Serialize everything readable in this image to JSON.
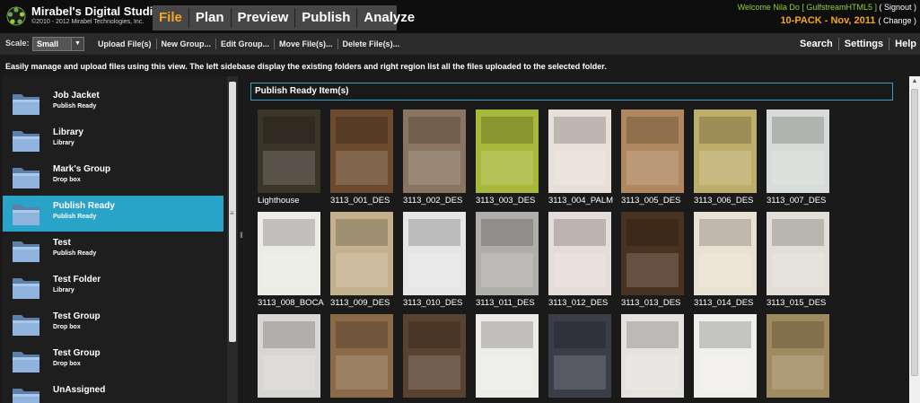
{
  "app": {
    "title": "Mirabel's Digital Studio",
    "copyright": "©2010 - 2012 Mirabel Technologies, Inc."
  },
  "nav": {
    "tabs": [
      {
        "label": "File",
        "active": true
      },
      {
        "label": "Plan"
      },
      {
        "label": "Preview"
      },
      {
        "label": "Publish"
      },
      {
        "label": "Analyze"
      }
    ]
  },
  "user": {
    "welcome": "Welcome Nila Do [ GulfstreamHTML5 ]",
    "signout": "( Signout )",
    "package": "10-PACK - Nov, 2011",
    "change": "( Change )"
  },
  "toolbar": {
    "scale_label": "Scale:",
    "scale_value": "Small",
    "buttons": [
      "Upload File(s)",
      "New Group...",
      "Edit Group...",
      "Move File(s)...",
      "Delete File(s)..."
    ],
    "right_buttons": [
      "Search",
      "Settings",
      "Help"
    ]
  },
  "info": "Easily manage and upload files using this view. The left sidebase display the existing folders and right region list all the files uploaded to the selected folder.",
  "sidebar": {
    "folders": [
      {
        "name": "Job Jacket",
        "sub": "Publish Ready"
      },
      {
        "name": "Library",
        "sub": "Library"
      },
      {
        "name": "Mark's Group",
        "sub": "Drop box"
      },
      {
        "name": "Publish Ready",
        "sub": "Publish Ready",
        "active": true
      },
      {
        "name": "Test",
        "sub": "Publish Ready"
      },
      {
        "name": "Test Folder",
        "sub": "Library"
      },
      {
        "name": "Test Group",
        "sub": "Drop box"
      },
      {
        "name": "Test Group",
        "sub": "Drop box"
      },
      {
        "name": "UnAssigned",
        "sub": ""
      }
    ]
  },
  "main": {
    "section_title": "Publish Ready Item(s)",
    "items": [
      {
        "caption": "Lighthouse",
        "color": "#3a3528"
      },
      {
        "caption": "3113_001_DES",
        "color": "#6b4a2e"
      },
      {
        "caption": "3113_002_DES",
        "color": "#8a7560"
      },
      {
        "caption": "3113_003_DES",
        "color": "#a8b83a"
      },
      {
        "caption": "3113_004_PALM",
        "color": "#e8e0d8"
      },
      {
        "caption": "3113_005_DES",
        "color": "#b08860"
      },
      {
        "caption": "3113_006_DES",
        "color": "#bfae6a"
      },
      {
        "caption": "3113_007_DES",
        "color": "#d8dcd8"
      },
      {
        "caption": "3113_008_BOCA",
        "color": "#ecebe6"
      },
      {
        "caption": "3113_009_DES",
        "color": "#c4b08c"
      },
      {
        "caption": "3113_010_DES",
        "color": "#e6e6e6"
      },
      {
        "caption": "3113_011_DES",
        "color": "#b0aeaa"
      },
      {
        "caption": "3113_012_DES",
        "color": "#e4dcd8"
      },
      {
        "caption": "3113_013_DES",
        "color": "#4a3220"
      },
      {
        "caption": "3113_014_DES",
        "color": "#e8e2d2"
      },
      {
        "caption": "3113_015_DES",
        "color": "#e2ddd6"
      },
      {
        "caption": "",
        "color": "#d8d6d2"
      },
      {
        "caption": "",
        "color": "#8a6a48"
      },
      {
        "caption": "",
        "color": "#5a4230"
      },
      {
        "caption": "",
        "color": "#ecebe8"
      },
      {
        "caption": "",
        "color": "#3a3e48"
      },
      {
        "caption": "",
        "color": "#e6e3de"
      },
      {
        "caption": "",
        "color": "#f0efec"
      },
      {
        "caption": "",
        "color": "#a08a60"
      }
    ]
  }
}
